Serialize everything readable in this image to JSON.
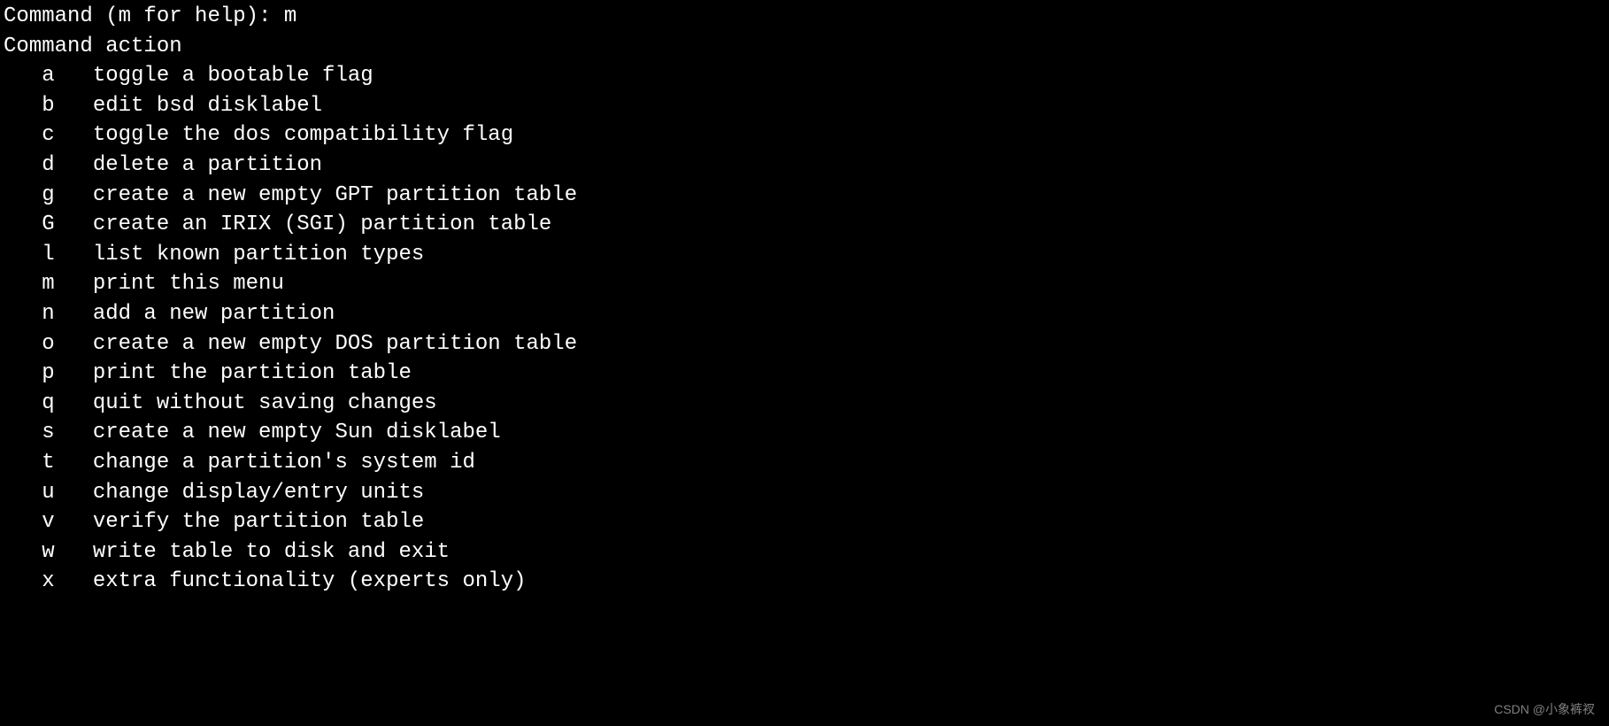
{
  "prompt": {
    "text": "Command (m for help): ",
    "input": "m"
  },
  "header": "Command action",
  "commands": [
    {
      "key": "a",
      "desc": "toggle a bootable flag"
    },
    {
      "key": "b",
      "desc": "edit bsd disklabel"
    },
    {
      "key": "c",
      "desc": "toggle the dos compatibility flag"
    },
    {
      "key": "d",
      "desc": "delete a partition"
    },
    {
      "key": "g",
      "desc": "create a new empty GPT partition table"
    },
    {
      "key": "G",
      "desc": "create an IRIX (SGI) partition table"
    },
    {
      "key": "l",
      "desc": "list known partition types"
    },
    {
      "key": "m",
      "desc": "print this menu"
    },
    {
      "key": "n",
      "desc": "add a new partition"
    },
    {
      "key": "o",
      "desc": "create a new empty DOS partition table"
    },
    {
      "key": "p",
      "desc": "print the partition table"
    },
    {
      "key": "q",
      "desc": "quit without saving changes"
    },
    {
      "key": "s",
      "desc": "create a new empty Sun disklabel"
    },
    {
      "key": "t",
      "desc": "change a partition's system id"
    },
    {
      "key": "u",
      "desc": "change display/entry units"
    },
    {
      "key": "v",
      "desc": "verify the partition table"
    },
    {
      "key": "w",
      "desc": "write table to disk and exit"
    },
    {
      "key": "x",
      "desc": "extra functionality (experts only)"
    }
  ],
  "watermark": "CSDN @小象裤衩"
}
